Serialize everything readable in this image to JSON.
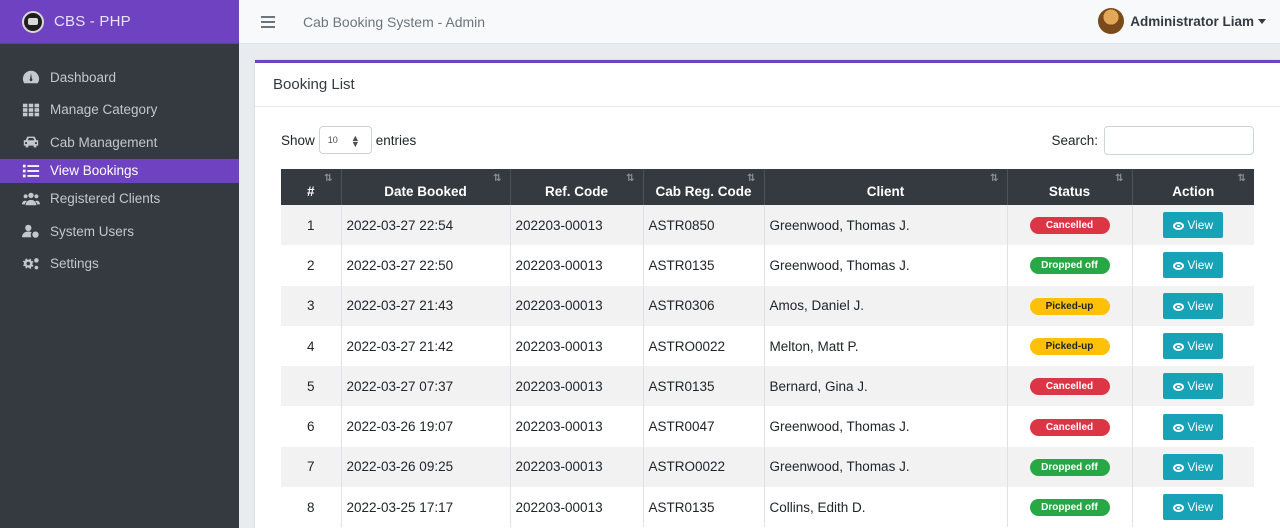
{
  "brand": {
    "name": "CBS - PHP"
  },
  "header": {
    "title": "Cab Booking System - Admin",
    "user": "Administrator Liam"
  },
  "sidebar": {
    "items": [
      {
        "label": "Dashboard",
        "icon": "dashboard-icon"
      },
      {
        "label": "Manage Category",
        "icon": "grid-icon"
      },
      {
        "label": "Cab Management",
        "icon": "car-icon"
      },
      {
        "label": "View Bookings",
        "icon": "list-icon",
        "active": true
      },
      {
        "label": "Registered Clients",
        "icon": "users-icon"
      },
      {
        "label": "System Users",
        "icon": "user-gear-icon"
      },
      {
        "label": "Settings",
        "icon": "gears-icon"
      }
    ]
  },
  "card": {
    "title": "Booking List",
    "show_label": "Show",
    "entries_value": "10",
    "entries_label": "entries",
    "search_label": "Search:"
  },
  "table": {
    "columns": [
      "#",
      "Date Booked",
      "Ref. Code",
      "Cab Reg. Code",
      "Client",
      "Status",
      "Action"
    ],
    "action_label": "View",
    "rows": [
      {
        "num": "1",
        "date": "2022-03-27 22:54",
        "ref": "202203-00013",
        "cab": "ASTR0850",
        "client": "Greenwood, Thomas J.",
        "status": "Cancelled"
      },
      {
        "num": "2",
        "date": "2022-03-27 22:50",
        "ref": "202203-00013",
        "cab": "ASTR0135",
        "client": "Greenwood, Thomas J.",
        "status": "Dropped off"
      },
      {
        "num": "3",
        "date": "2022-03-27 21:43",
        "ref": "202203-00013",
        "cab": "ASTR0306",
        "client": "Amos, Daniel J.",
        "status": "Picked-up"
      },
      {
        "num": "4",
        "date": "2022-03-27 21:42",
        "ref": "202203-00013",
        "cab": "ASTRO0022",
        "client": "Melton, Matt P.",
        "status": "Picked-up"
      },
      {
        "num": "5",
        "date": "2022-03-27 07:37",
        "ref": "202203-00013",
        "cab": "ASTR0135",
        "client": "Bernard, Gina J.",
        "status": "Cancelled"
      },
      {
        "num": "6",
        "date": "2022-03-26 19:07",
        "ref": "202203-00013",
        "cab": "ASTR0047",
        "client": "Greenwood, Thomas J.",
        "status": "Cancelled"
      },
      {
        "num": "7",
        "date": "2022-03-26 09:25",
        "ref": "202203-00013",
        "cab": "ASTRO0022",
        "client": "Greenwood, Thomas J.",
        "status": "Dropped off"
      },
      {
        "num": "8",
        "date": "2022-03-25 17:17",
        "ref": "202203-00013",
        "cab": "ASTR0135",
        "client": "Collins, Edith D.",
        "status": "Dropped off"
      }
    ]
  },
  "status_colors": {
    "Cancelled": "#dc3545",
    "Dropped off": "#28a745",
    "Picked-up": "#ffc107"
  },
  "theme": {
    "accent": "#6f42c1",
    "sidebar": "#343a40",
    "action": "#17a2b8"
  }
}
